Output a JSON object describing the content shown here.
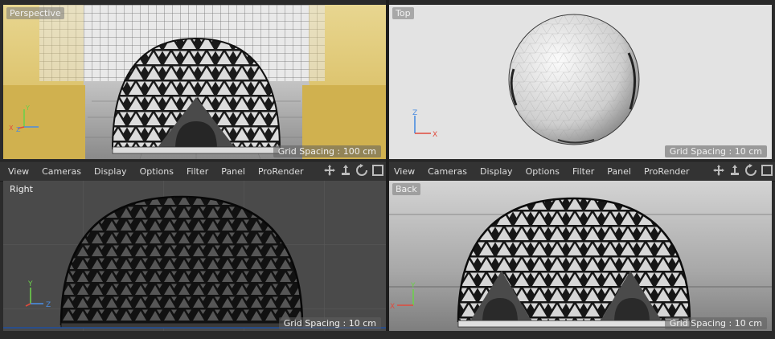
{
  "viewports": {
    "perspective": {
      "label": "Perspective",
      "grid": "Grid Spacing : 100 cm",
      "axes": [
        "X",
        "Y",
        "Z"
      ]
    },
    "top": {
      "label": "Top",
      "grid": "Grid Spacing : 10 cm",
      "axes": [
        "X",
        "Z"
      ]
    },
    "right": {
      "label": "Right",
      "grid": "Grid Spacing : 10 cm",
      "axes": [
        "Y",
        "Z"
      ]
    },
    "back": {
      "label": "Back",
      "grid": "Grid Spacing : 10 cm",
      "axes": [
        "X",
        "Y"
      ]
    }
  },
  "menus": {
    "left": [
      "View",
      "Cameras",
      "Display",
      "Options",
      "Filter",
      "Panel",
      "ProRender"
    ],
    "right": [
      "View",
      "Cameras",
      "Display",
      "Options",
      "Filter",
      "Panel",
      "ProRender"
    ]
  },
  "nav_icons": [
    "move-view-icon",
    "dolly-view-icon",
    "rotate-view-icon",
    "maximize-view-icon"
  ],
  "colors": {
    "axis_x": "#e04a3c",
    "axis_y": "#6cd04a",
    "axis_z": "#4a8ce0",
    "highlight_yellow": "#d4b552",
    "gray_background": "#e3e3e3"
  }
}
